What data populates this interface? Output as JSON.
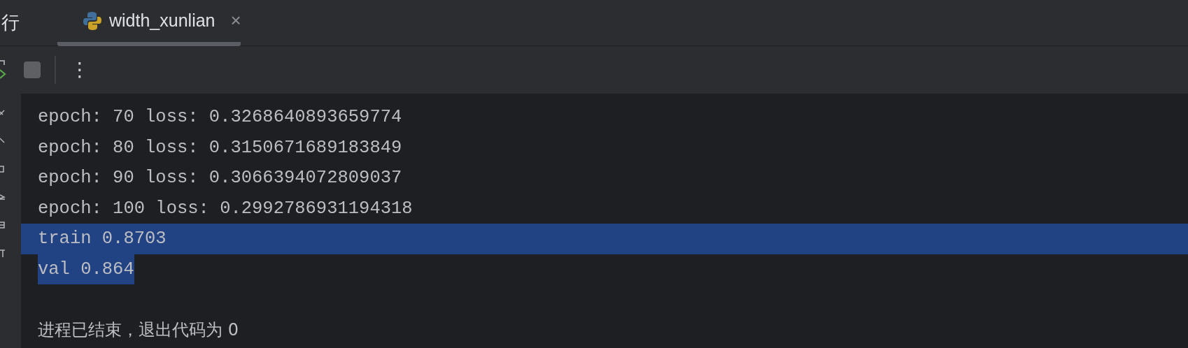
{
  "header": {
    "title": "行",
    "tabs": [
      {
        "label": "width_xunlian",
        "close": "×",
        "selected": true
      }
    ]
  },
  "toolbar": {
    "menu": "⋮"
  },
  "console": {
    "lines": [
      {
        "text": "epoch: 70 loss: 0.3268640893659774",
        "selected": false
      },
      {
        "text": "epoch: 80 loss: 0.3150671689183849",
        "selected": false
      },
      {
        "text": "epoch: 90 loss: 0.3066394072809037",
        "selected": false
      },
      {
        "text": "epoch: 100 loss: 0.2992786931194318",
        "selected": false
      },
      {
        "text": "train 0.8703",
        "selected": true
      },
      {
        "text": "val 0.864",
        "selected": true
      },
      {
        "text": "进程已结束，退出代码为 0",
        "selected": false,
        "kind": "status"
      }
    ]
  }
}
